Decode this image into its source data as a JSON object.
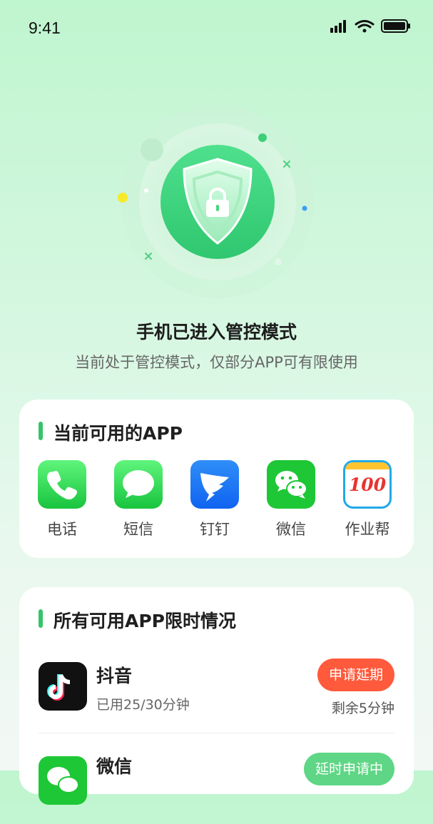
{
  "status_bar": {
    "time": "9:41"
  },
  "hero": {
    "title": "手机已进入管控模式",
    "subtitle": "当前处于管控模式，仅部分APP可有限使用"
  },
  "available": {
    "title": "当前可用的APP",
    "apps": [
      {
        "label": "电话",
        "icon": "phone-icon"
      },
      {
        "label": "短信",
        "icon": "message-icon"
      },
      {
        "label": "钉钉",
        "icon": "dingtalk-icon"
      },
      {
        "label": "微信",
        "icon": "wechat-icon"
      },
      {
        "label": "作业帮",
        "icon": "zuoyebang-icon",
        "badge_text": "100"
      }
    ]
  },
  "limits": {
    "title": "所有可用APP限时情况",
    "items": [
      {
        "name": "抖音",
        "usage": "已用25/30分钟",
        "action": "申请延期",
        "remaining": "剩余5分钟",
        "icon": "douyin-icon"
      },
      {
        "name": "微信",
        "usage": "",
        "action": "延时申请中",
        "remaining": "",
        "icon": "wechat-icon"
      }
    ]
  },
  "colors": {
    "accent": "#35c46a",
    "warning": "#ff5a3c",
    "pending": "#5fd685"
  }
}
